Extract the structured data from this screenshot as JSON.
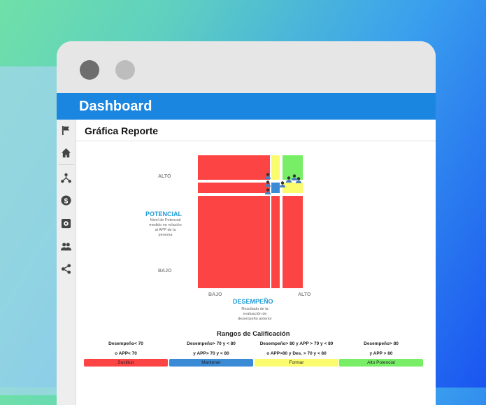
{
  "window": {
    "title": "Dashboard"
  },
  "page": {
    "title": "Gráfica Reporte"
  },
  "sidebar": {
    "icons": [
      "flag-icon",
      "home-icon",
      "hierarchy-icon",
      "dollar-icon",
      "settings-icon",
      "people-icon",
      "share-icon"
    ]
  },
  "chart": {
    "y_high": "ALTO",
    "y_low": "BAJO",
    "y_title": "POTENCIAL",
    "y_desc_1": "Nivel de Potencial",
    "y_desc_2": "medido en relación",
    "y_desc_3": "al APP de la",
    "y_desc_4": "persona",
    "x_low": "BAJO",
    "x_high": "ALTO",
    "x_title": "DESEMPEÑO",
    "x_desc_1": "Resultado de la",
    "x_desc_2": "evaluación de",
    "x_desc_3": "desempeño anterior"
  },
  "colors": {
    "sustituir": "#fd4444",
    "mantener": "#3a8ad6",
    "formar": "#fbfb6e",
    "alto_potencial": "#77ee66"
  },
  "ranges": {
    "title": "Rangos de Calificación",
    "items": [
      {
        "line1": "Desempeño< 70",
        "line2": "o APP< 70",
        "label": "Sustituir"
      },
      {
        "line1": "Desempeño> 70 y < 80",
        "line2": "y APP> 70 y < 80",
        "label": "Mantener"
      },
      {
        "line1": "Desempeño> 80 y APP > 70 y < 80",
        "line2": "o APP>80 y Des. > 70 y < 80",
        "label": "Formar"
      },
      {
        "line1": "Desempeño> 80",
        "line2": "y APP > 80",
        "label": "Alto Potencial"
      }
    ]
  }
}
